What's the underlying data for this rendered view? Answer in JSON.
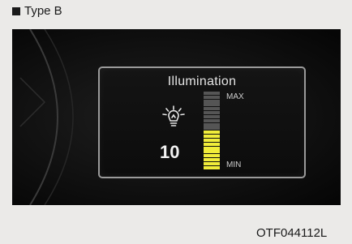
{
  "caption": {
    "type_label": "Type B",
    "figure_code": "OTF044112L"
  },
  "display": {
    "title": "Illumination",
    "value": "10",
    "max_label": "MAX",
    "min_label": "MIN",
    "icon": "light-bulb-icon",
    "level": {
      "current": 10,
      "max": 20
    },
    "colors": {
      "bar_active": "#f0ec3a",
      "bar_inactive": "#555555",
      "panel_border": "#9a9a9a"
    }
  }
}
